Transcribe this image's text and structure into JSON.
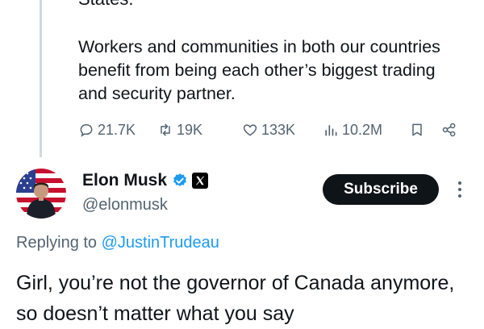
{
  "parent_tweet": {
    "cut_line": "States.",
    "text": "Workers and communities in both our countries benefit from being each other’s biggest trading and security partner.",
    "actions": {
      "replies": "21.7K",
      "reposts": "19K",
      "likes": "133K",
      "views": "10.2M"
    }
  },
  "reply": {
    "author_name": "Elon Musk",
    "handle": "@elonmusk",
    "subscribe_label": "Subscribe",
    "replying_to_prefix": "Replying to ",
    "replying_to_handle": "@JustinTrudeau",
    "text": "Girl, you’re not the governor of Canada anymore, so doesn’t matter what you say"
  },
  "icons": {
    "reply": "reply-icon",
    "repost": "repost-icon",
    "like": "heart-icon",
    "views": "views-icon",
    "bookmark": "bookmark-icon",
    "share": "share-icon",
    "verified": "verified-badge-icon",
    "affiliation": "x-logo-icon",
    "more": "more-vertical-icon"
  },
  "colors": {
    "text": "#0f1419",
    "muted": "#536471",
    "link": "#1d9bf0",
    "button": "#0f1419"
  }
}
